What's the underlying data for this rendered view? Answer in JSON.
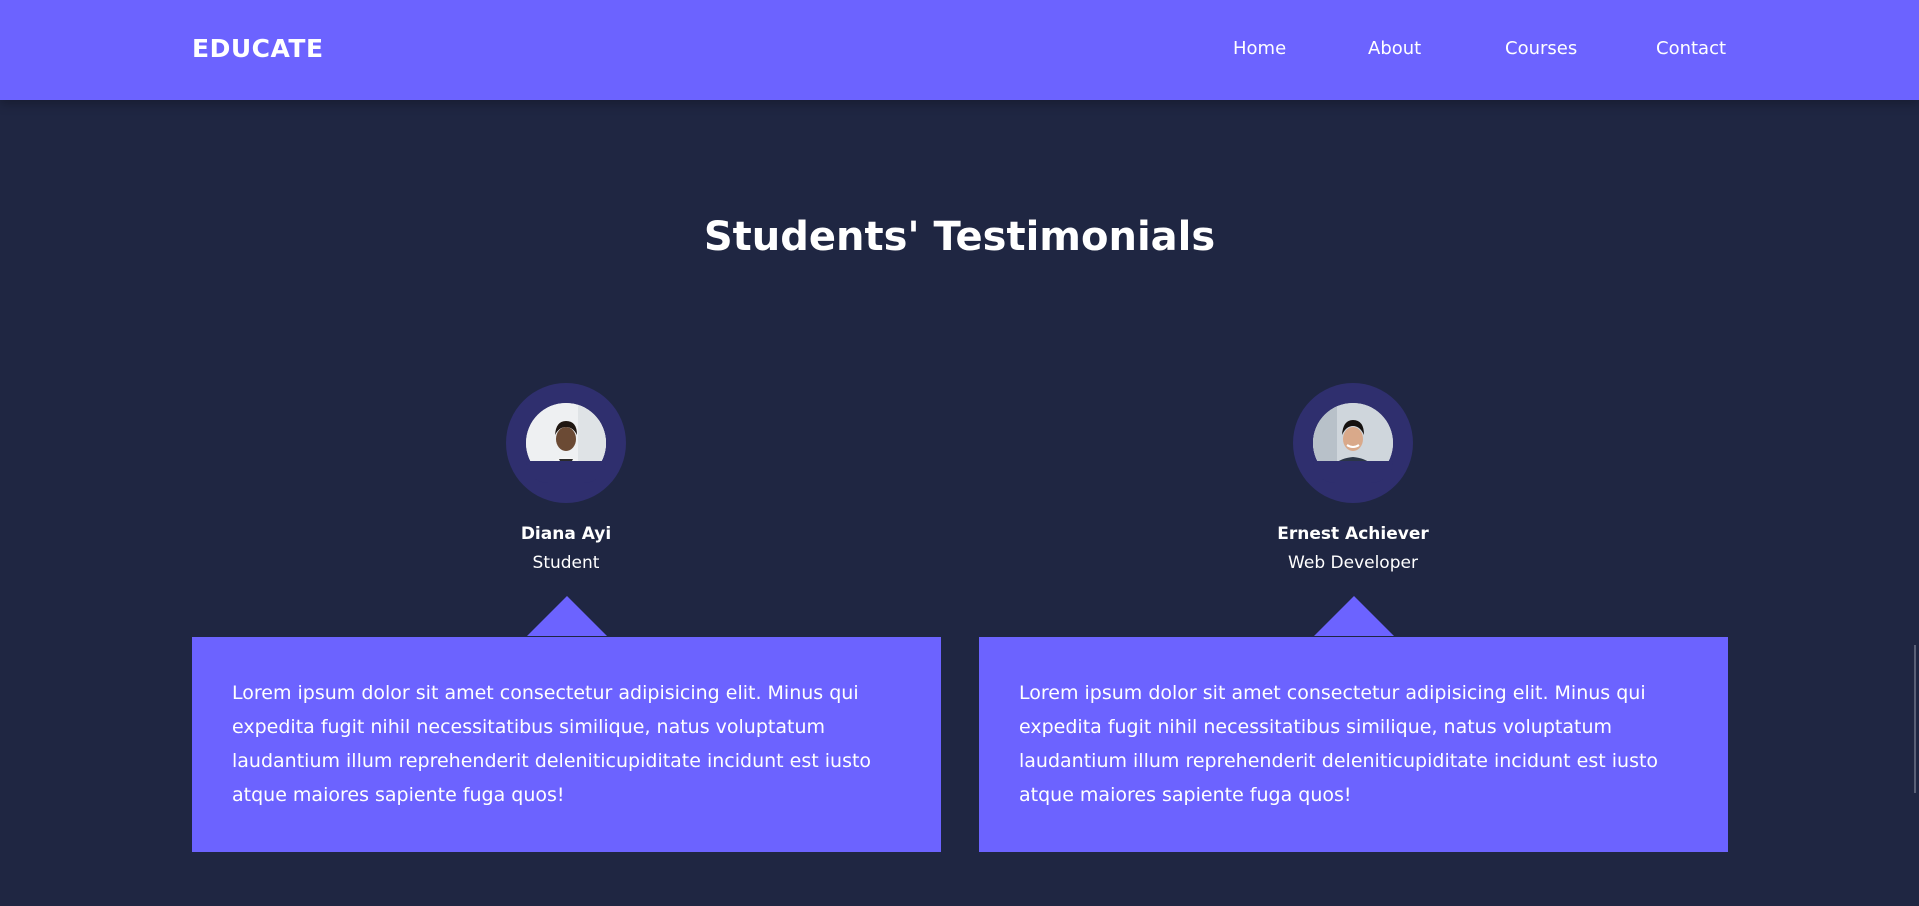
{
  "navbar": {
    "brand": "EDUCATE",
    "links": [
      "Home",
      "About",
      "Courses",
      "Contact"
    ]
  },
  "section": {
    "title": "Students' Testimonials"
  },
  "testimonials": [
    {
      "name": "Diana Ayi",
      "role": "Student",
      "text": "Lorem ipsum dolor sit amet consectetur adipisicing elit. Minus qui expedita fugit nihil necessitatibus similique, natus voluptatum laudantium illum reprehenderit deleniticupiditate incidunt est iusto atque maiores sapiente fuga quos!"
    },
    {
      "name": "Ernest Achiever",
      "role": "Web Developer",
      "text": "Lorem ipsum dolor sit amet consectetur adipisicing elit. Minus qui expedita fugit nihil necessitatibus similique, natus voluptatum laudantium illum reprehenderit deleniticupiditate incidunt est iusto atque maiores sapiente fuga quos!"
    }
  ],
  "colors": {
    "accent": "#6c63ff",
    "background": "#1f2642",
    "avatar_ring": "#2f2f6e"
  }
}
